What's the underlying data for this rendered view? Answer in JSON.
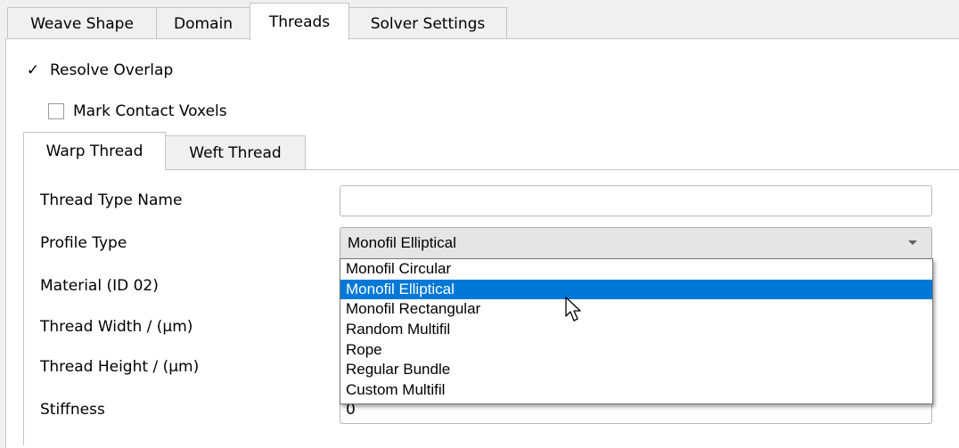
{
  "outer_tabs": [
    {
      "label": "Weave Shape"
    },
    {
      "label": "Domain"
    },
    {
      "label": "Threads"
    },
    {
      "label": "Solver Settings"
    }
  ],
  "options": {
    "resolve_overlap": {
      "label": "Resolve Overlap",
      "checked": true,
      "check_glyph": "✓"
    },
    "mark_contact_voxels": {
      "label": "Mark Contact Voxels",
      "checked": false
    }
  },
  "inner_tabs": [
    {
      "label": "Warp Thread"
    },
    {
      "label": "Weft Thread"
    }
  ],
  "form": {
    "thread_type_name": {
      "label": "Thread Type Name",
      "value": ""
    },
    "profile_type": {
      "label": "Profile Type",
      "value": "Monofil Elliptical"
    },
    "material": {
      "label": "Material (ID 02)"
    },
    "thread_width": {
      "label": "Thread Width / (μm)"
    },
    "thread_height": {
      "label": "Thread Height / (μm)"
    },
    "stiffness": {
      "label": "Stiffness",
      "value": "0"
    }
  },
  "dropdown": {
    "items": [
      "Monofil Circular",
      "Monofil Elliptical",
      "Monofil Rectangular",
      "Random Multifil",
      "Rope",
      "Regular Bundle",
      "Custom Multifil"
    ],
    "selected": "Monofil Elliptical"
  },
  "colors": {
    "selection": "#0078d7",
    "window_bg": "#f0f0f0",
    "pane_bg": "#ffffff"
  }
}
